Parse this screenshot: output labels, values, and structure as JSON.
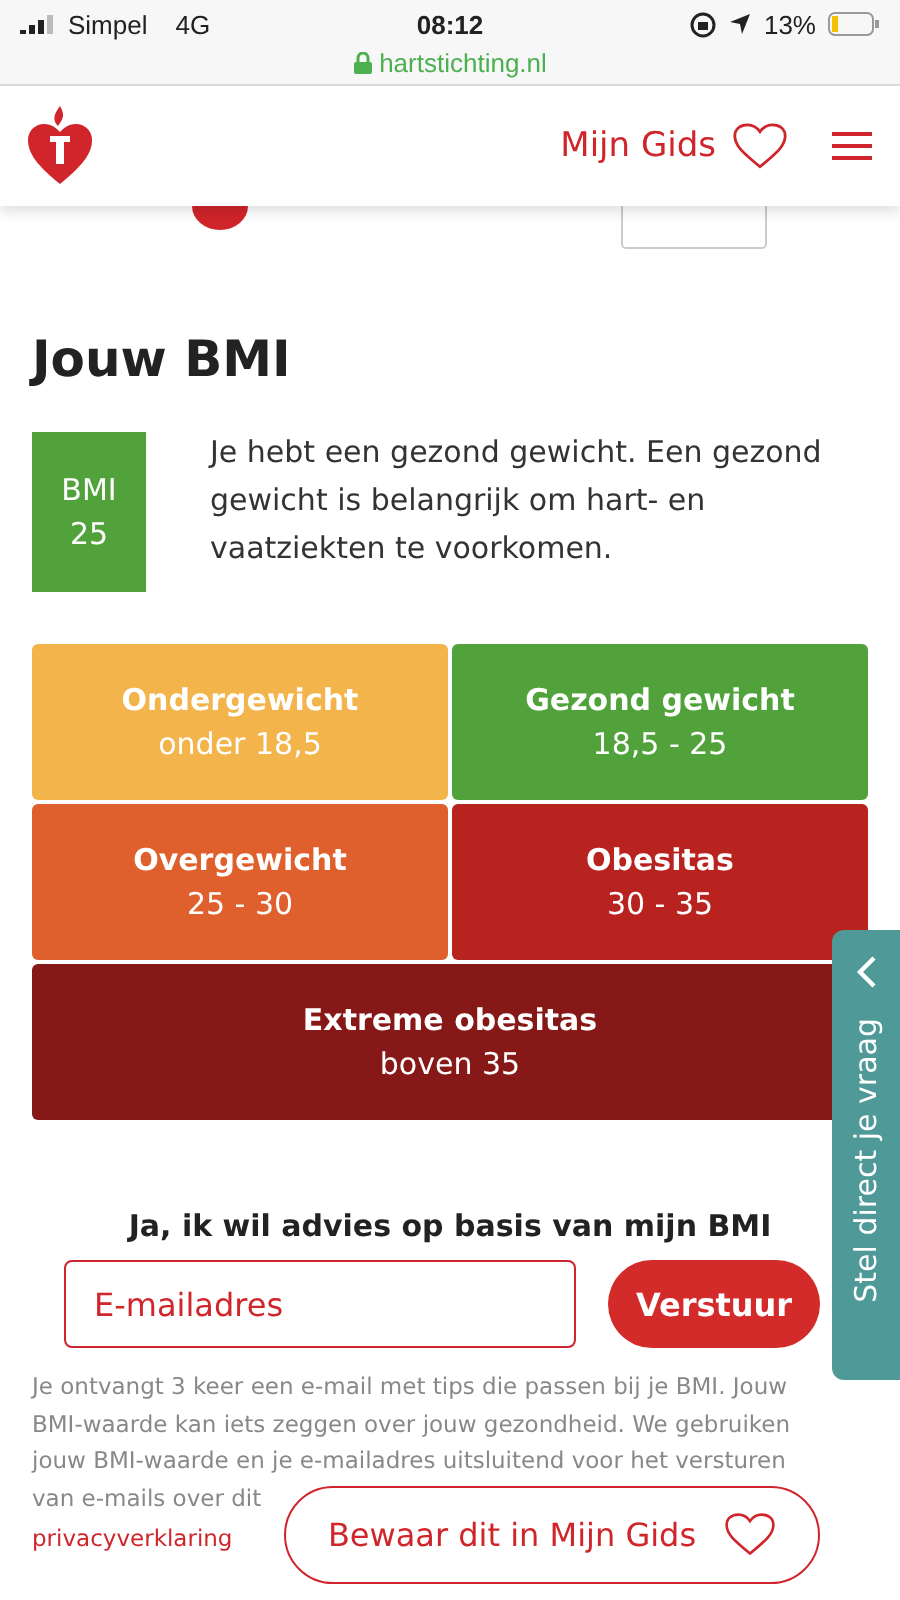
{
  "status_bar": {
    "carrier": "Simpel",
    "network": "4G",
    "time": "08:12",
    "battery": "13%",
    "url": "hartstichting.nl"
  },
  "header": {
    "guide_link": "Mijn Gids"
  },
  "result": {
    "title": "Jouw BMI",
    "badge_label": "BMI",
    "badge_value": "25",
    "message": "Je hebt een gezond gewicht. Een gezond gewicht is belangrijk om hart- en vaatziekten te voorkomen."
  },
  "categories": [
    {
      "name": "Ondergewicht",
      "range": "onder 18,5",
      "color": "#f2b44b",
      "wide": false
    },
    {
      "name": "Gezond gewicht",
      "range": "18,5 - 25",
      "color": "#52a23c",
      "wide": false
    },
    {
      "name": "Overgewicht",
      "range": "25 - 30",
      "color": "#e0602d",
      "wide": false
    },
    {
      "name": "Obesitas",
      "range": "30 - 35",
      "color": "#b8221f",
      "wide": false
    },
    {
      "name": "Extreme obesitas",
      "range": "boven 35",
      "color": "#861818",
      "wide": true
    }
  ],
  "advice": {
    "heading": "Ja, ik wil advies op basis van mijn BMI",
    "email_placeholder": "E-mailadres",
    "submit": "Verstuur",
    "disclaimer": "Je ontvangt 3 keer een e-mail met tips die passen bij je BMI. Jouw BMI-waarde kan iets zeggen over jouw gezondheid. We gebruiken jouw BMI-waarde en je e-mailadres uitsluitend voor het versturen van e-mails over dit",
    "privacy_link": "privacyverklaring"
  },
  "side_tab": {
    "label": "Stel direct je vraag"
  },
  "save_button": {
    "label": "Bewaar dit in Mijn Gids"
  }
}
